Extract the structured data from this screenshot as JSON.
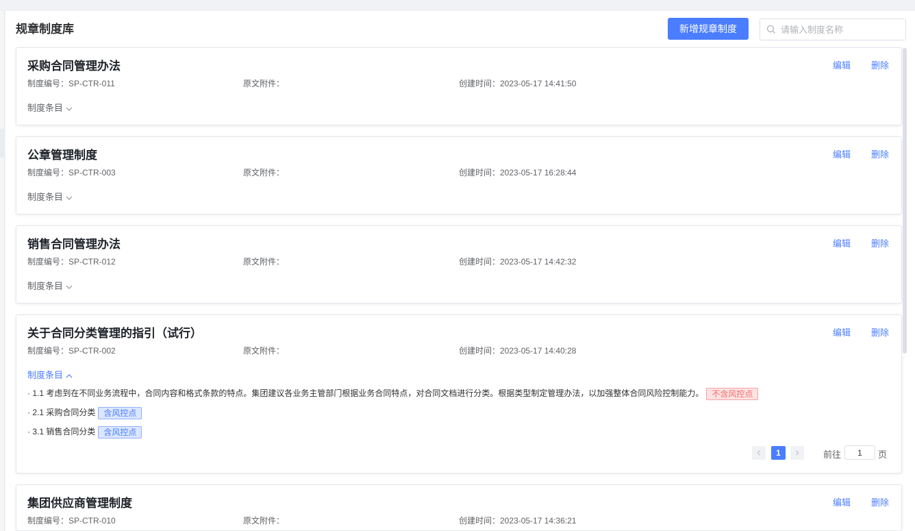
{
  "page": {
    "title": "规章制度库",
    "add_button": "新增规章制度",
    "search_placeholder": "请输入制度名称"
  },
  "labels": {
    "edit": "编辑",
    "delete": "删除",
    "items_toggle": "制度条目"
  },
  "colors": {
    "primary": "#4a7dff",
    "danger": "#f56c6c"
  },
  "regulations": [
    {
      "title": "采购合同管理办法",
      "code": "制度编号：SP-CTR-011",
      "attachment": "原文附件：",
      "created": "创建时间：2023-05-17 14:41:50"
    },
    {
      "title": "公章管理制度",
      "code": "制度编号：SP-CTR-003",
      "attachment": "原文附件：",
      "created": "创建时间：2023-05-17 16:28:44"
    },
    {
      "title": "销售合同管理办法",
      "code": "制度编号：SP-CTR-012",
      "attachment": "原文附件：",
      "created": "创建时间：2023-05-17 14:42:32"
    },
    {
      "title": "关于合同分类管理的指引（试行）",
      "code": "制度编号：SP-CTR-002",
      "attachment": "原文附件：",
      "created": "创建时间：2023-05-17 14:40:28",
      "items": [
        {
          "text": "· 1.1 考虑到在不同业务流程中，合同内容和格式条款的特点。集团建议各业务主管部门根据业务合同特点，对合同文档进行分类。根据类型制定管理办法，以加强整体合同风险控制能力。",
          "tag": "不含风控点"
        },
        {
          "text": "· 2.1 采购合同分类",
          "tag": "含风控点"
        },
        {
          "text": "· 3.1 销售合同分类",
          "tag": "含风控点"
        }
      ],
      "pagination": {
        "current": "1",
        "goto_label": "前往",
        "goto_value": "1",
        "goto_unit": "页"
      }
    },
    {
      "title": "集团供应商管理制度",
      "code": "制度编号：SP-CTR-010",
      "attachment": "原文附件：",
      "created": "创建时间：2023-05-17 14:36:21"
    }
  ]
}
